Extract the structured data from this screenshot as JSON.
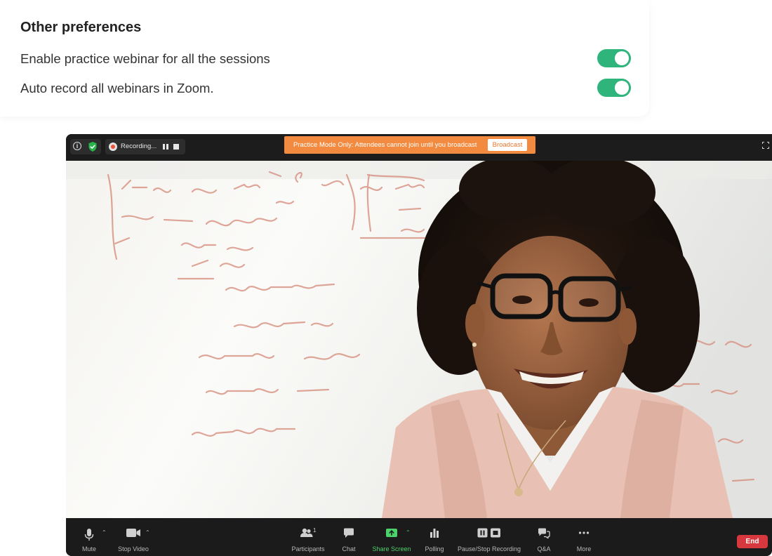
{
  "preferences": {
    "title": "Other preferences",
    "items": [
      {
        "label": "Enable practice webinar for all the sessions",
        "enabled": true
      },
      {
        "label": "Auto record all webinars in Zoom.",
        "enabled": true
      }
    ],
    "toggle_color": "#2fb57b"
  },
  "meeting": {
    "recording_label": "Recording...",
    "info_icon_glyph": "i",
    "practice_banner": "Practice Mode Only: Attendees cannot join until you broadcast",
    "broadcast_label": "Broadcast",
    "banner_color": "#f28b40",
    "toolbar": {
      "mute": "Mute",
      "stop_video": "Stop Video",
      "participants": "Participants",
      "participants_count": "1",
      "chat": "Chat",
      "share_screen": "Share Screen",
      "polling": "Polling",
      "pause_stop_recording": "Pause/Stop Recording",
      "qa": "Q&A",
      "more": "More",
      "end": "End"
    },
    "end_color": "#d6383e"
  }
}
